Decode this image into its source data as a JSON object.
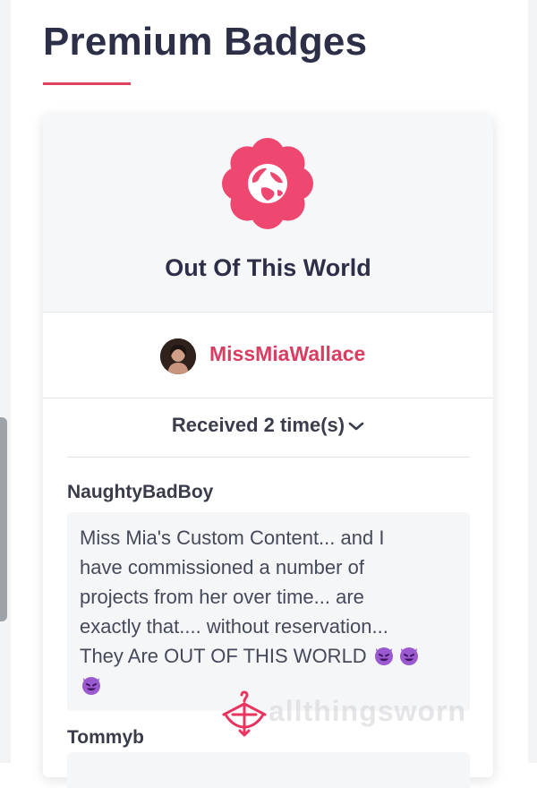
{
  "page": {
    "title": "Premium Badges"
  },
  "badge": {
    "name": "Out Of This World",
    "icon": "globe-flower-badge-icon",
    "color": "#ee4870"
  },
  "owner": {
    "name": "MissMiaWallace",
    "avatar": "user-avatar"
  },
  "received": {
    "label": "Received 2 time(s)",
    "icon": "chevron-down-icon"
  },
  "reviews": [
    {
      "user": "NaughtyBadBoy",
      "lines": [
        "Miss Mia's Custom Content... and I",
        "have commissioned a number of",
        "projects from her over time... are",
        "exactly that.... without reservation...",
        "They Are OUT OF THIS WORLD"
      ],
      "emoji": "smiling-devil-emoji"
    },
    {
      "user": "Tommyb"
    }
  ],
  "watermark": {
    "text": "allthingsworn",
    "icon": "hanger-bow-logo-icon"
  },
  "colors": {
    "accent": "#e0415f",
    "link": "#d93d61",
    "heading": "#2c2f47"
  }
}
